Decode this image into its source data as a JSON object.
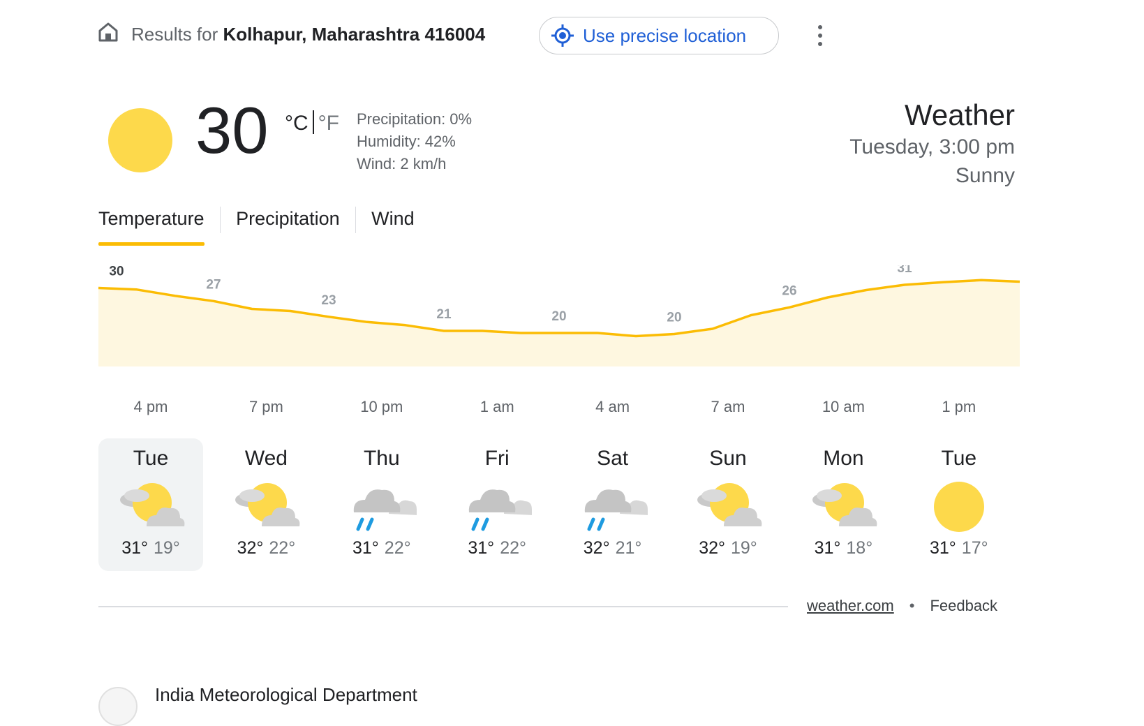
{
  "location": {
    "prefix": "Results for ",
    "place": "Kolhapur, Maharashtra 416004",
    "precise_button": "Use precise location"
  },
  "current": {
    "temp": "30",
    "unit_c": "°C",
    "unit_f": "°F",
    "precipitation": "Precipitation: 0%",
    "humidity": "Humidity: 42%",
    "wind": "Wind: 2 km/h",
    "title": "Weather",
    "datetime": "Tuesday, 3:00 pm",
    "condition": "Sunny",
    "icon": "sun-icon"
  },
  "tabs": [
    {
      "label": "Temperature",
      "active": true
    },
    {
      "label": "Precipitation",
      "active": false
    },
    {
      "label": "Wind",
      "active": false
    }
  ],
  "colors": {
    "accent": "#fbbc04",
    "chart_fill": "#fef7e0",
    "chart_line": "#fbbc04",
    "sun": "#fdd94b",
    "link_blue": "#1f5fd6"
  },
  "chart_data": {
    "type": "area",
    "x": [
      "3 pm",
      "4 pm",
      "5 pm",
      "6 pm",
      "7 pm",
      "8 pm",
      "9 pm",
      "10 pm",
      "11 pm",
      "12 am",
      "1 am",
      "2 am",
      "3 am",
      "4 am",
      "5 am",
      "6 am",
      "7 am",
      "8 am",
      "9 am",
      "10 am",
      "11 am",
      "12 pm",
      "1 pm",
      "2 pm",
      "3 pm"
    ],
    "values": [
      30,
      29.7,
      28.5,
      27.5,
      26,
      25.6,
      24.5,
      23.5,
      22.9,
      21.8,
      21.8,
      21.4,
      21.4,
      21.4,
      20.8,
      21.2,
      22.2,
      24.8,
      26.3,
      28.2,
      29.6,
      30.6,
      31.1,
      31.5,
      31.2
    ],
    "labels": [
      {
        "index": 0,
        "text": "30"
      },
      {
        "index": 3,
        "text": "27"
      },
      {
        "index": 6,
        "text": "23"
      },
      {
        "index": 9,
        "text": "21"
      },
      {
        "index": 12,
        "text": "20"
      },
      {
        "index": 15,
        "text": "20"
      },
      {
        "index": 18,
        "text": "26"
      },
      {
        "index": 21,
        "text": "31"
      }
    ],
    "tick_labels": [
      "4 pm",
      "7 pm",
      "10 pm",
      "1 am",
      "4 am",
      "7 am",
      "10 am",
      "1 pm"
    ],
    "ylim": [
      15,
      33
    ],
    "grid": false
  },
  "days": [
    {
      "name": "Tue",
      "icon": "partly-cloudy-icon",
      "high": "31°",
      "low": "19°",
      "selected": true
    },
    {
      "name": "Wed",
      "icon": "partly-cloudy-icon",
      "high": "32°",
      "low": "22°",
      "selected": false
    },
    {
      "name": "Thu",
      "icon": "rain-cloud-icon",
      "high": "31°",
      "low": "22°",
      "selected": false
    },
    {
      "name": "Fri",
      "icon": "rain-cloud-icon",
      "high": "31°",
      "low": "22°",
      "selected": false
    },
    {
      "name": "Sat",
      "icon": "rain-cloud-icon",
      "high": "32°",
      "low": "21°",
      "selected": false
    },
    {
      "name": "Sun",
      "icon": "partly-cloudy-icon",
      "high": "32°",
      "low": "19°",
      "selected": false
    },
    {
      "name": "Mon",
      "icon": "partly-cloudy-icon",
      "high": "31°",
      "low": "18°",
      "selected": false
    },
    {
      "name": "Tue",
      "icon": "sun-icon",
      "high": "31°",
      "low": "17°",
      "selected": false
    }
  ],
  "footer": {
    "source": "weather.com",
    "dot": "•",
    "feedback": "Feedback"
  },
  "imd": {
    "name": "India Meteorological Department"
  }
}
